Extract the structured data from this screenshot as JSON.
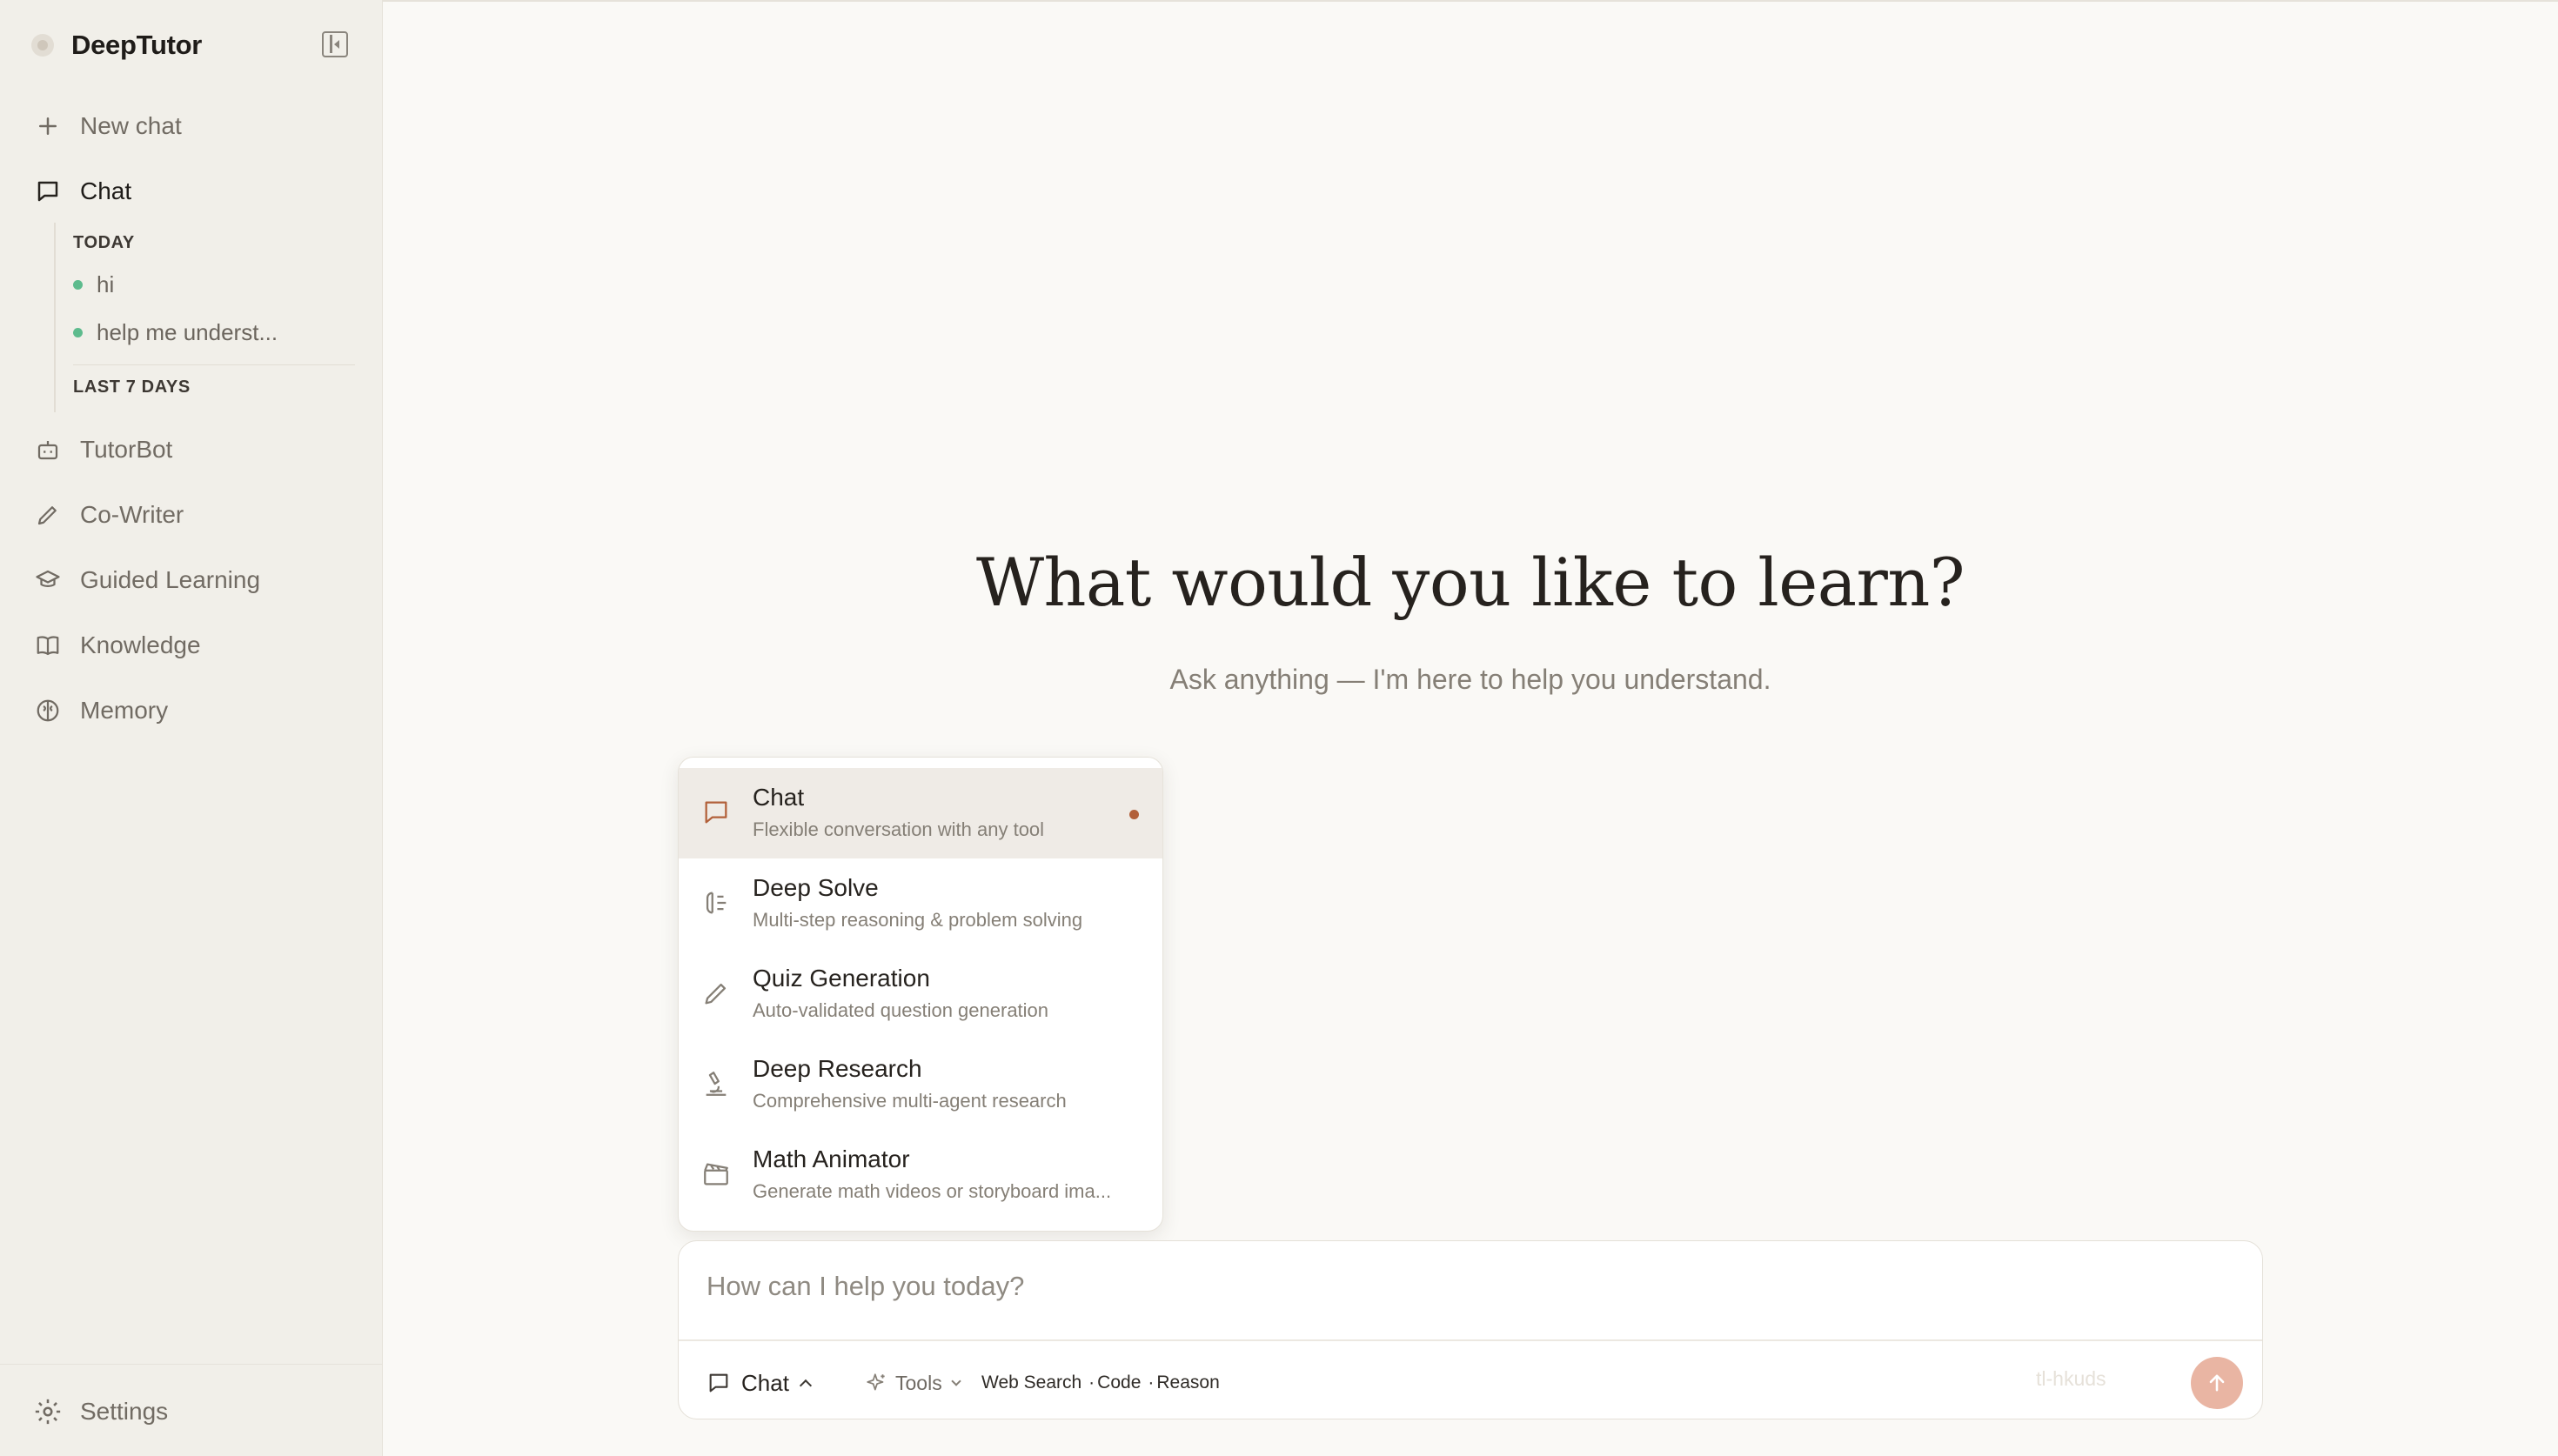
{
  "sidebar": {
    "brand": "DeepTutor",
    "new_chat": "New chat",
    "chat": "Chat",
    "history": {
      "today_label": "TODAY",
      "today": [
        "hi",
        "help me underst..."
      ],
      "last7_label": "LAST 7 DAYS"
    },
    "nav": [
      "TutorBot",
      "Co-Writer",
      "Guided Learning",
      "Knowledge",
      "Memory"
    ],
    "settings": "Settings"
  },
  "hero": {
    "title": "What would you like to learn?",
    "subtitle": "Ask anything — I'm here to help you understand."
  },
  "modes": [
    {
      "title": "Chat",
      "desc": "Flexible conversation with any tool",
      "icon": "chat-icon",
      "selected": true
    },
    {
      "title": "Deep Solve",
      "desc": "Multi-step reasoning & problem solving",
      "icon": "brain-icon"
    },
    {
      "title": "Quiz Generation",
      "desc": "Auto-validated question generation",
      "icon": "pencil-icon"
    },
    {
      "title": "Deep Research",
      "desc": "Comprehensive multi-agent research",
      "icon": "microscope-icon"
    },
    {
      "title": "Math Animator",
      "desc": "Generate math videos or storyboard ima...",
      "icon": "clapperboard-icon"
    }
  ],
  "composer": {
    "placeholder": "How can I help you today?",
    "mode_label": "Chat",
    "tools_label": "Tools",
    "tools": [
      "Web Search",
      "Code",
      "Reason"
    ],
    "model_hint": "tl-hkuds"
  },
  "colors": {
    "accent": "#b2603a",
    "send": "#e9b5a3",
    "online_dot": "#5dbb8d",
    "background": "#faf9f6",
    "sidebar": "#f1efe9"
  }
}
